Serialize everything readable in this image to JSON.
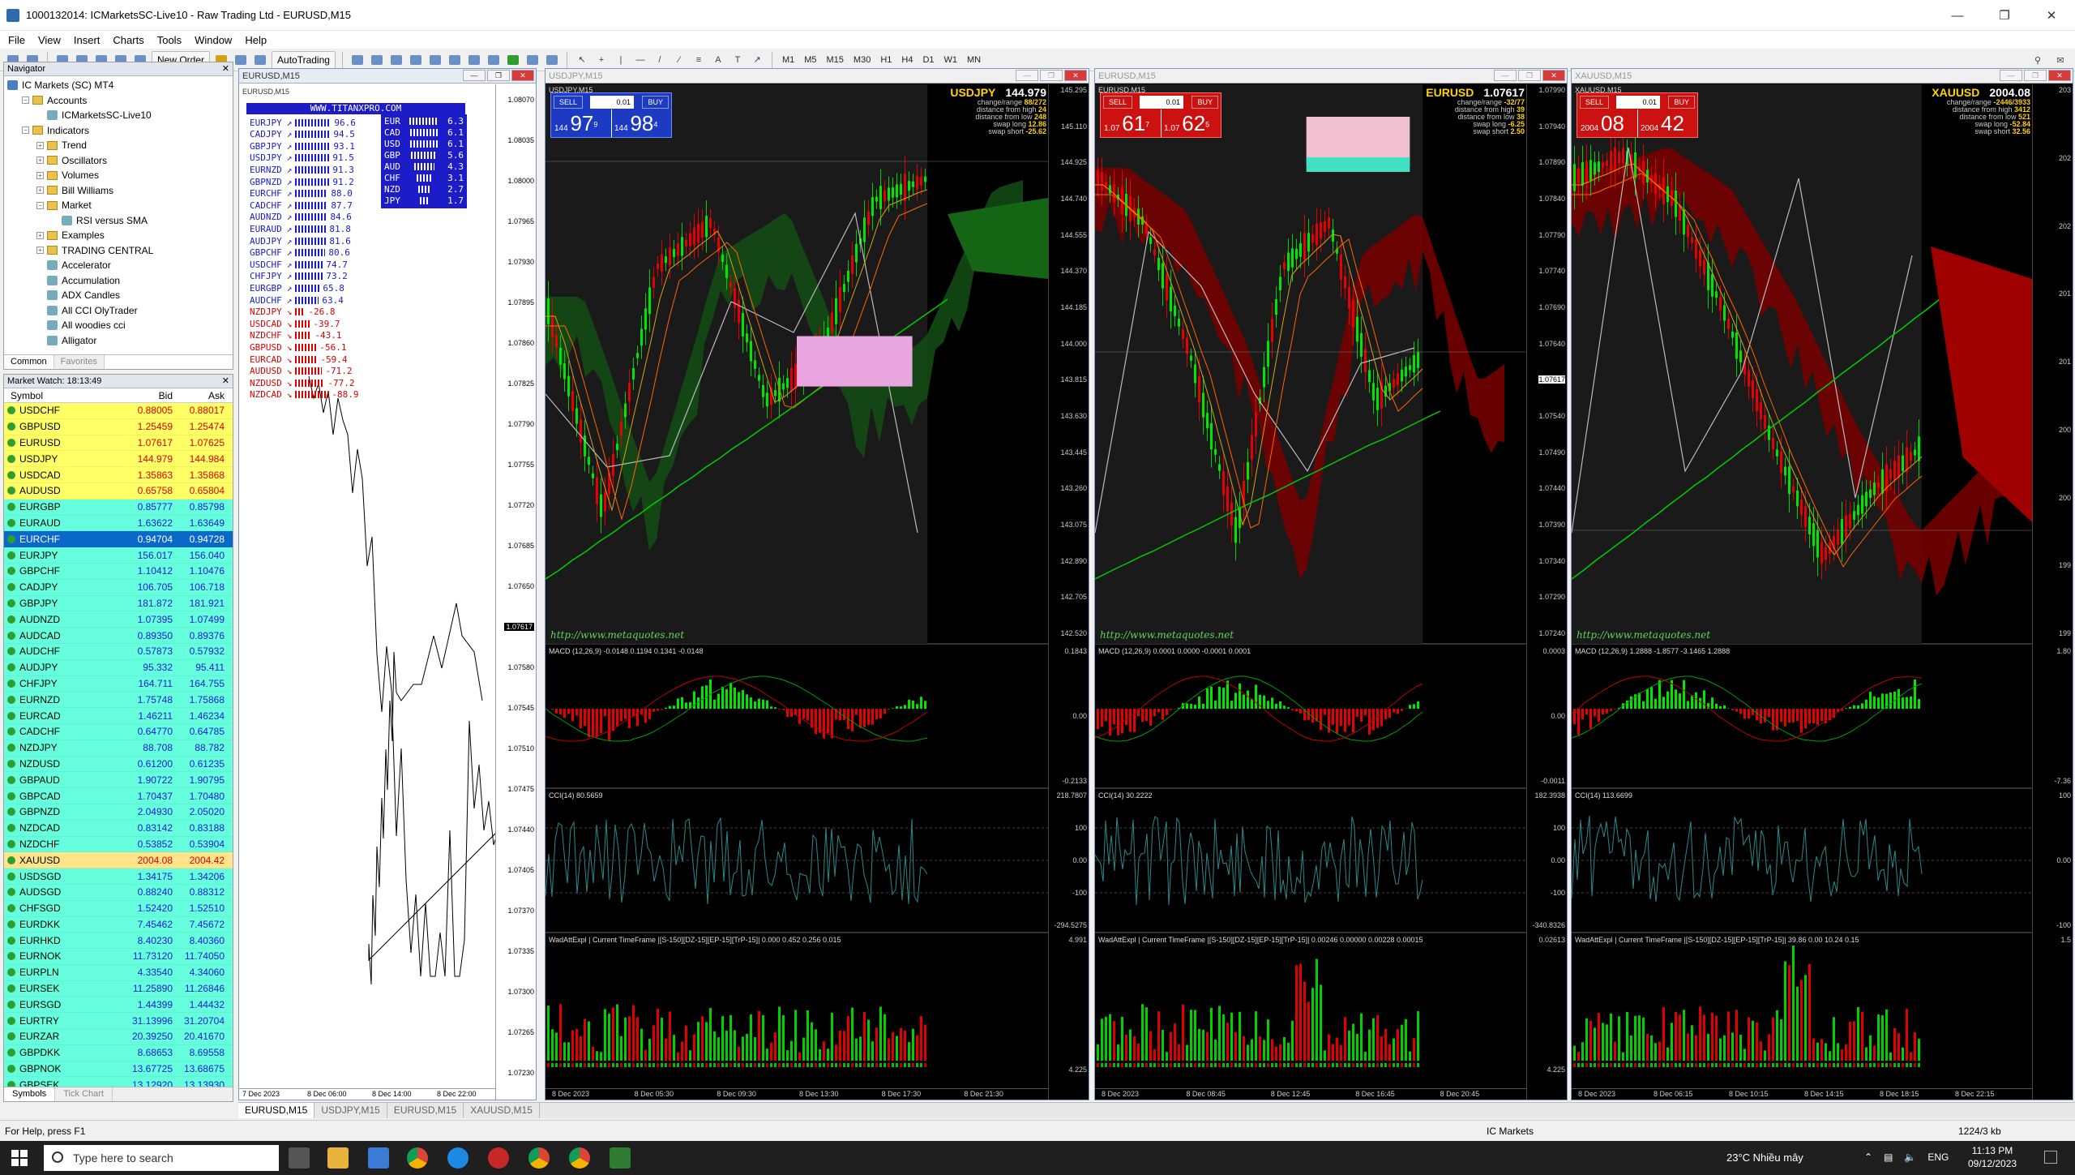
{
  "window": {
    "title": "1000132014: ICMarketsSC-Live10 - Raw Trading Ltd - EURUSD,M15"
  },
  "menu": [
    "File",
    "View",
    "Insert",
    "Charts",
    "Tools",
    "Window",
    "Help"
  ],
  "toolbar": {
    "new_order": "New Order",
    "autotrading": "AutoTrading",
    "timeframes": [
      "M1",
      "M5",
      "M15",
      "M30",
      "H1",
      "H4",
      "D1",
      "W1",
      "MN"
    ]
  },
  "navigator": {
    "title": "Navigator",
    "tree": [
      {
        "label": "IC Markets (SC) MT4",
        "level": 0,
        "type": "root"
      },
      {
        "label": "Accounts",
        "level": 1,
        "type": "folder"
      },
      {
        "label": "ICMarketsSC-Live10",
        "level": 2,
        "type": "item"
      },
      {
        "label": "Indicators",
        "level": 1,
        "type": "folder"
      },
      {
        "label": "Trend",
        "level": 2,
        "type": "folder"
      },
      {
        "label": "Oscillators",
        "level": 2,
        "type": "folder"
      },
      {
        "label": "Volumes",
        "level": 2,
        "type": "folder"
      },
      {
        "label": "Bill Williams",
        "level": 2,
        "type": "folder"
      },
      {
        "label": "Market",
        "level": 2,
        "type": "folder"
      },
      {
        "label": "RSI versus SMA",
        "level": 3,
        "type": "item"
      },
      {
        "label": "Examples",
        "level": 2,
        "type": "folder"
      },
      {
        "label": "TRADING CENTRAL",
        "level": 2,
        "type": "folder"
      },
      {
        "label": "Accelerator",
        "level": 2,
        "type": "item"
      },
      {
        "label": "Accumulation",
        "level": 2,
        "type": "item"
      },
      {
        "label": "ADX Candles",
        "level": 2,
        "type": "item"
      },
      {
        "label": "All CCI OlyTrader",
        "level": 2,
        "type": "item"
      },
      {
        "label": "All woodies cci",
        "level": 2,
        "type": "item"
      },
      {
        "label": "Alligator",
        "level": 2,
        "type": "item"
      }
    ],
    "tabs": [
      "Common",
      "Favorites"
    ]
  },
  "market_watch": {
    "title": "Market Watch: 18:13:49",
    "columns": [
      "Symbol",
      "Bid",
      "Ask"
    ],
    "rows": [
      {
        "s": "USDCHF",
        "b": "0.88005",
        "a": "0.88017",
        "c": "y"
      },
      {
        "s": "GBPUSD",
        "b": "1.25459",
        "a": "1.25474",
        "c": "y"
      },
      {
        "s": "EURUSD",
        "b": "1.07617",
        "a": "1.07625",
        "c": "y"
      },
      {
        "s": "USDJPY",
        "b": "144.979",
        "a": "144.984",
        "c": "y"
      },
      {
        "s": "USDCAD",
        "b": "1.35863",
        "a": "1.35868",
        "c": "y"
      },
      {
        "s": "AUDUSD",
        "b": "0.65758",
        "a": "0.65804",
        "c": "y"
      },
      {
        "s": "EURGBP",
        "b": "0.85777",
        "a": "0.85798",
        "c": "c"
      },
      {
        "s": "EURAUD",
        "b": "1.63622",
        "a": "1.63649",
        "c": "c"
      },
      {
        "s": "EURCHF",
        "b": "0.94704",
        "a": "0.94728",
        "c": "s"
      },
      {
        "s": "EURJPY",
        "b": "156.017",
        "a": "156.040",
        "c": "c"
      },
      {
        "s": "GBPCHF",
        "b": "1.10412",
        "a": "1.10476",
        "c": "c"
      },
      {
        "s": "CADJPY",
        "b": "106.705",
        "a": "106.718",
        "c": "c"
      },
      {
        "s": "GBPJPY",
        "b": "181.872",
        "a": "181.921",
        "c": "c"
      },
      {
        "s": "AUDNZD",
        "b": "1.07395",
        "a": "1.07499",
        "c": "c"
      },
      {
        "s": "AUDCAD",
        "b": "0.89350",
        "a": "0.89376",
        "c": "c"
      },
      {
        "s": "AUDCHF",
        "b": "0.57873",
        "a": "0.57932",
        "c": "c"
      },
      {
        "s": "AUDJPY",
        "b": "95.332",
        "a": "95.411",
        "c": "c"
      },
      {
        "s": "CHFJPY",
        "b": "164.711",
        "a": "164.755",
        "c": "c"
      },
      {
        "s": "EURNZD",
        "b": "1.75748",
        "a": "1.75868",
        "c": "c"
      },
      {
        "s": "EURCAD",
        "b": "1.46211",
        "a": "1.46234",
        "c": "c"
      },
      {
        "s": "CADCHF",
        "b": "0.64770",
        "a": "0.64785",
        "c": "c"
      },
      {
        "s": "NZDJPY",
        "b": "88.708",
        "a": "88.782",
        "c": "c"
      },
      {
        "s": "NZDUSD",
        "b": "0.61200",
        "a": "0.61235",
        "c": "c"
      },
      {
        "s": "GBPAUD",
        "b": "1.90722",
        "a": "1.90795",
        "c": "c"
      },
      {
        "s": "GBPCAD",
        "b": "1.70437",
        "a": "1.70480",
        "c": "c"
      },
      {
        "s": "GBPNZD",
        "b": "2.04930",
        "a": "2.05020",
        "c": "c"
      },
      {
        "s": "NZDCAD",
        "b": "0.83142",
        "a": "0.83188",
        "c": "c"
      },
      {
        "s": "NZDCHF",
        "b": "0.53852",
        "a": "0.53904",
        "c": "c"
      },
      {
        "s": "XAUUSD",
        "b": "2004.08",
        "a": "2004.42",
        "c": "g"
      },
      {
        "s": "USDSGD",
        "b": "1.34175",
        "a": "1.34206",
        "c": "c"
      },
      {
        "s": "AUDSGD",
        "b": "0.88240",
        "a": "0.88312",
        "c": "c"
      },
      {
        "s": "CHFSGD",
        "b": "1.52420",
        "a": "1.52510",
        "c": "c"
      },
      {
        "s": "EURDKK",
        "b": "7.45462",
        "a": "7.45672",
        "c": "c"
      },
      {
        "s": "EURHKD",
        "b": "8.40230",
        "a": "8.40360",
        "c": "c"
      },
      {
        "s": "EURNOK",
        "b": "11.73120",
        "a": "11.74050",
        "c": "c"
      },
      {
        "s": "EURPLN",
        "b": "4.33540",
        "a": "4.34060",
        "c": "c"
      },
      {
        "s": "EURSEK",
        "b": "11.25890",
        "a": "11.26846",
        "c": "c"
      },
      {
        "s": "EURSGD",
        "b": "1.44399",
        "a": "1.44432",
        "c": "c"
      },
      {
        "s": "EURTRY",
        "b": "31.13996",
        "a": "31.20704",
        "c": "c"
      },
      {
        "s": "EURZAR",
        "b": "20.39250",
        "a": "20.41670",
        "c": "c"
      },
      {
        "s": "GBPDKK",
        "b": "8.68653",
        "a": "8.69558",
        "c": "c"
      },
      {
        "s": "GBPNOK",
        "b": "13.67725",
        "a": "13.68675",
        "c": "c"
      },
      {
        "s": "GBPSEK",
        "b": "13.12920",
        "a": "13.13930",
        "c": "c"
      }
    ],
    "tabs": [
      "Symbols",
      "Tick Chart"
    ]
  },
  "eurusd_window": {
    "title": "EURUSD,M15",
    "inner_title": "EURUSD,M15",
    "strength_title": "WWW.TITANXPRO.COM",
    "pairs": [
      {
        "p": "EURJPY",
        "v": "96.6"
      },
      {
        "p": "CADJPY",
        "v": "94.5"
      },
      {
        "p": "GBPJPY",
        "v": "93.1"
      },
      {
        "p": "USDJPY",
        "v": "91.5"
      },
      {
        "p": "EURNZD",
        "v": "91.3"
      },
      {
        "p": "GBPNZD",
        "v": "91.2"
      },
      {
        "p": "EURCHF",
        "v": "88.0"
      },
      {
        "p": "CADCHF",
        "v": "87.7"
      },
      {
        "p": "AUDNZD",
        "v": "84.6"
      },
      {
        "p": "EURAUD",
        "v": "81.8"
      },
      {
        "p": "AUDJPY",
        "v": "81.6"
      },
      {
        "p": "GBPCHF",
        "v": "80.6"
      },
      {
        "p": "USDCHF",
        "v": "74.7"
      },
      {
        "p": "CHFJPY",
        "v": "73.2"
      },
      {
        "p": "EURGBP",
        "v": "65.8"
      },
      {
        "p": "AUDCHF",
        "v": "63.4"
      },
      {
        "p": "NZDJPY",
        "v": "-26.8"
      },
      {
        "p": "USDCAD",
        "v": "-39.7"
      },
      {
        "p": "NZDCHF",
        "v": "-43.1"
      },
      {
        "p": "GBPUSD",
        "v": "-56.1"
      },
      {
        "p": "EURCAD",
        "v": "-59.4"
      },
      {
        "p": "AUDUSD",
        "v": "-71.2"
      },
      {
        "p": "NZDUSD",
        "v": "-77.2"
      },
      {
        "p": "NZDCAD",
        "v": "-88.9"
      }
    ],
    "currencies": [
      {
        "c": "EUR",
        "v": "6.3"
      },
      {
        "c": "CAD",
        "v": "6.1"
      },
      {
        "c": "USD",
        "v": "6.1"
      },
      {
        "c": "GBP",
        "v": "5.6"
      },
      {
        "c": "AUD",
        "v": "4.3"
      },
      {
        "c": "CHF",
        "v": "3.1"
      },
      {
        "c": "NZD",
        "v": "2.7"
      },
      {
        "c": "JPY",
        "v": "1.7"
      }
    ],
    "y_ticks": [
      "1.08070",
      "1.08035",
      "1.08000",
      "1.07965",
      "1.07930",
      "1.07895",
      "1.07860",
      "1.07825",
      "1.07790",
      "1.07755",
      "1.07720",
      "1.07685",
      "1.07650",
      "1.07617",
      "1.07580",
      "1.07545",
      "1.07510",
      "1.07475",
      "1.07440",
      "1.07405",
      "1.07370",
      "1.07335",
      "1.07300",
      "1.07265",
      "1.07230"
    ],
    "x_ticks": [
      "7 Dec 2023",
      "8 Dec 06:00",
      "8 Dec 14:00",
      "8 Dec 22:00"
    ],
    "current_price": "1.07617"
  },
  "charts": [
    {
      "id": "usdjpy",
      "title": "USDJPY,M15",
      "inner_title": "USDJPY,M15",
      "symbol": "USDJPY",
      "price": "144.979",
      "info": [
        "change/range",
        "distance from high",
        "distance from low",
        "swap long",
        "swap short"
      ],
      "info_vals": [
        "88/272",
        "24",
        "248",
        "12.86",
        "-25.62"
      ],
      "panel_color": "blue",
      "lot": "0.01",
      "bid_big": "97",
      "bid_pre": "144",
      "bid_sup": "9",
      "ask_big": "98",
      "ask_pre": "144",
      "ask_sup": "4",
      "y_ticks": [
        "145.295",
        "145.110",
        "144.925",
        "144.740",
        "144.555",
        "144.370",
        "144.185",
        "144.000",
        "143.815",
        "143.630",
        "143.445",
        "143.260",
        "143.075",
        "142.890",
        "142.705",
        "142.520"
      ],
      "macd": "MACD (12,26,9) -0.0148 0.1194 0.1341 -0.0148",
      "macd_ticks": [
        "0.1843",
        "0.00",
        "-0.2133"
      ],
      "cci": "CCI(14) 80.5659",
      "cci_ticks": [
        "218.7807",
        "100",
        "0.00",
        "-100",
        "-294.5275"
      ],
      "wad": "WadAttExpl | Current TimeFrame |[S-150][DZ-15][EP-15][TrP-15]| 0.000 0.452 0.256 0.015",
      "wad_ticks": [
        "4.991",
        "4.225"
      ],
      "x_ticks": [
        "8 Dec 2023",
        "8 Dec 05:30",
        "8 Dec 09:30",
        "8 Dec 13:30",
        "8 Dec 17:30",
        "8 Dec 21:30"
      ],
      "site": "http://www.metaquotes.net"
    },
    {
      "id": "eurusd",
      "title": "EURUSD,M15",
      "inner_title": "EURUSD,M15",
      "symbol": "EURUSD",
      "price": "1.07617",
      "info": [
        "change/range",
        "distance from high",
        "distance from low",
        "swap long",
        "swap short"
      ],
      "info_vals": [
        "-32/77",
        "39",
        "38",
        "-6.25",
        "2.50"
      ],
      "panel_color": "red",
      "lot": "0.01",
      "bid_big": "61",
      "bid_pre": "1.07",
      "bid_sup": "7",
      "ask_big": "62",
      "ask_pre": "1.07",
      "ask_sup": "5",
      "y_ticks": [
        "1.07990",
        "1.07940",
        "1.07890",
        "1.07840",
        "1.07790",
        "1.07740",
        "1.07690",
        "1.07640",
        "1.07617",
        "1.07540",
        "1.07490",
        "1.07440",
        "1.07390",
        "1.07340",
        "1.07290",
        "1.07240"
      ],
      "macd": "MACD (12,26,9) 0.0001 0.0000 -0.0001 0.0001",
      "macd_ticks": [
        "0.0003",
        "0.00",
        "-0.0011"
      ],
      "cci": "CCI(14) 30.2222",
      "cci_ticks": [
        "182.3938",
        "100",
        "0.00",
        "-100",
        "-340.8326"
      ],
      "wad": "WadAttExpl | Current TimeFrame |[S-150][DZ-15][EP-15][TrP-15]| 0.00246 0.00000 0.00228 0.00015",
      "wad_ticks": [
        "0.02613",
        "4.225"
      ],
      "x_ticks": [
        "8 Dec 2023",
        "8 Dec 08:45",
        "8 Dec 12:45",
        "8 Dec 16:45",
        "8 Dec 20:45"
      ],
      "site": "http://www.metaquotes.net"
    },
    {
      "id": "xauusd",
      "title": "XAUUSD,M15",
      "inner_title": "XAUUSD,M15",
      "symbol": "XAUUSD",
      "price": "2004.08",
      "info": [
        "change/range",
        "distance from high",
        "distance from low",
        "swap long",
        "swap short"
      ],
      "info_vals": [
        "-2446/3933",
        "3412",
        "521",
        "-52.84",
        "32.56"
      ],
      "panel_color": "red",
      "lot": "0.01",
      "bid_big": "08",
      "bid_pre": "2004",
      "bid_sup": "",
      "ask_big": "42",
      "ask_pre": "2004",
      "ask_sup": "",
      "y_ticks": [
        "203",
        "202",
        "202",
        "201",
        "201",
        "200",
        "200",
        "199",
        "199"
      ],
      "macd": "MACD (12,26,9) 1.2888 -1.8577 -3.1465 1.2888",
      "macd_ticks": [
        "1.80",
        "-7.36"
      ],
      "cci": "CCI(14) 113.6699",
      "cci_ticks": [
        "100",
        "0.00",
        "-100"
      ],
      "wad": "WadAttExpl | Current TimeFrame |[S-150][DZ-15][EP-15][TrP-15]| 39.86 0.00 10.24 0.15",
      "wad_ticks": [
        "1.5"
      ],
      "x_ticks": [
        "8 Dec 2023",
        "8 Dec 06:15",
        "8 Dec 10:15",
        "8 Dec 14:15",
        "8 Dec 18:15",
        "8 Dec 22:15"
      ],
      "site": "http://www.metaquotes.net"
    }
  ],
  "chart_tabs": [
    "EURUSD,M15",
    "USDJPY,M15",
    "EURUSD,M15",
    "XAUUSD,M15"
  ],
  "status": {
    "help": "For Help, press F1",
    "profile": "IC Markets",
    "traffic": "1224/3 kb"
  },
  "taskbar": {
    "search": "Type here to search",
    "weather": "23°C  Nhiều mây",
    "lang": "ENG",
    "time": "11:13 PM",
    "date": "09/12/2023"
  },
  "colors": {
    "bull": "#00e600",
    "bear": "#e60000",
    "ichimoku_green": "#1b5e20",
    "ichimoku_red": "#8b0000",
    "zone_pink": "#e8a5e0",
    "zone_teal": "#40e0c0",
    "bg": "#000000"
  }
}
